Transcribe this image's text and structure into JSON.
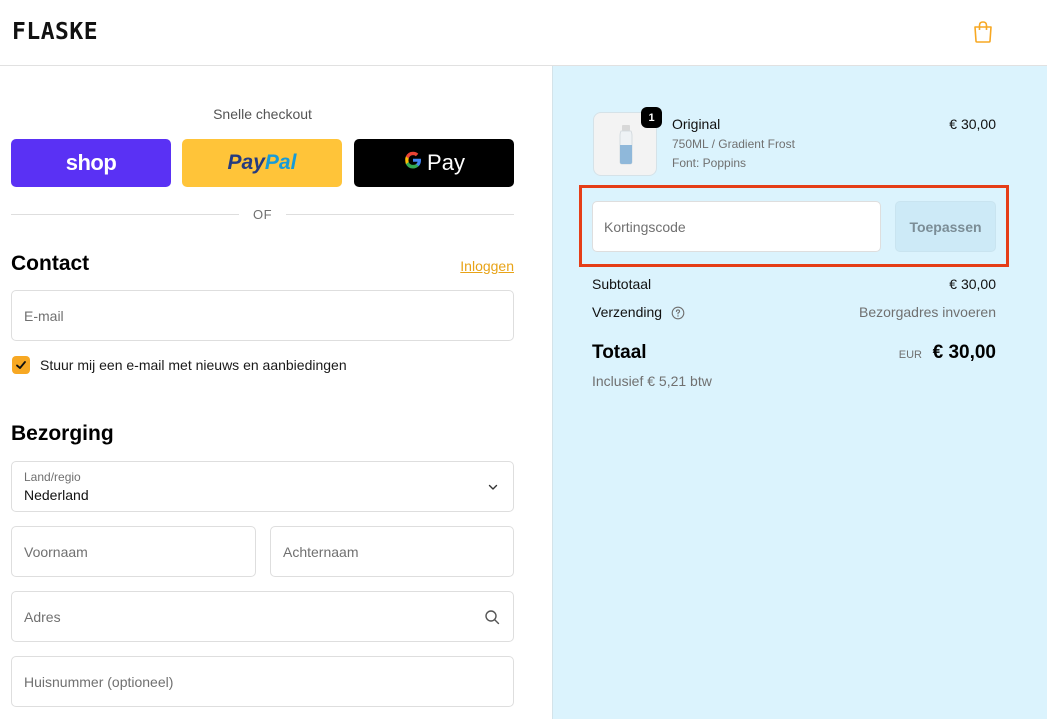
{
  "header": {
    "logo": "FLASKE",
    "cart_icon": "shopping-bag-icon",
    "accent_color": "#f7a823"
  },
  "express": {
    "title": "Snelle checkout",
    "shop_label": "shop",
    "paypal_label_1": "Pay",
    "paypal_label_2": "Pal",
    "gpay_g": "G",
    "gpay_label": "Pay",
    "divider_text": "OF"
  },
  "contact": {
    "heading": "Contact",
    "login_link": "Inloggen",
    "email_placeholder": "E-mail",
    "newsletter_label": "Stuur mij een e-mail met nieuws en aanbiedingen",
    "newsletter_checked": true
  },
  "delivery": {
    "heading": "Bezorging",
    "country_label": "Land/regio",
    "country_value": "Nederland",
    "first_name_placeholder": "Voornaam",
    "last_name_placeholder": "Achternaam",
    "address_placeholder": "Adres",
    "house_number_placeholder": "Huisnummer (optioneel)"
  },
  "summary": {
    "product": {
      "quantity": "1",
      "name": "Original",
      "variant": "750ML / Gradient Frost",
      "font": "Font: Poppins",
      "price": "€ 30,00"
    },
    "discount_placeholder": "Kortingscode",
    "apply_label": "Toepassen",
    "subtotal_label": "Subtotaal",
    "subtotal_value": "€ 30,00",
    "shipping_label": "Verzending",
    "shipping_value": "Bezorgadres invoeren",
    "total_label": "Totaal",
    "total_currency": "EUR",
    "total_value": "€ 30,00",
    "tax_note": "Inclusief € 5,21 btw"
  }
}
